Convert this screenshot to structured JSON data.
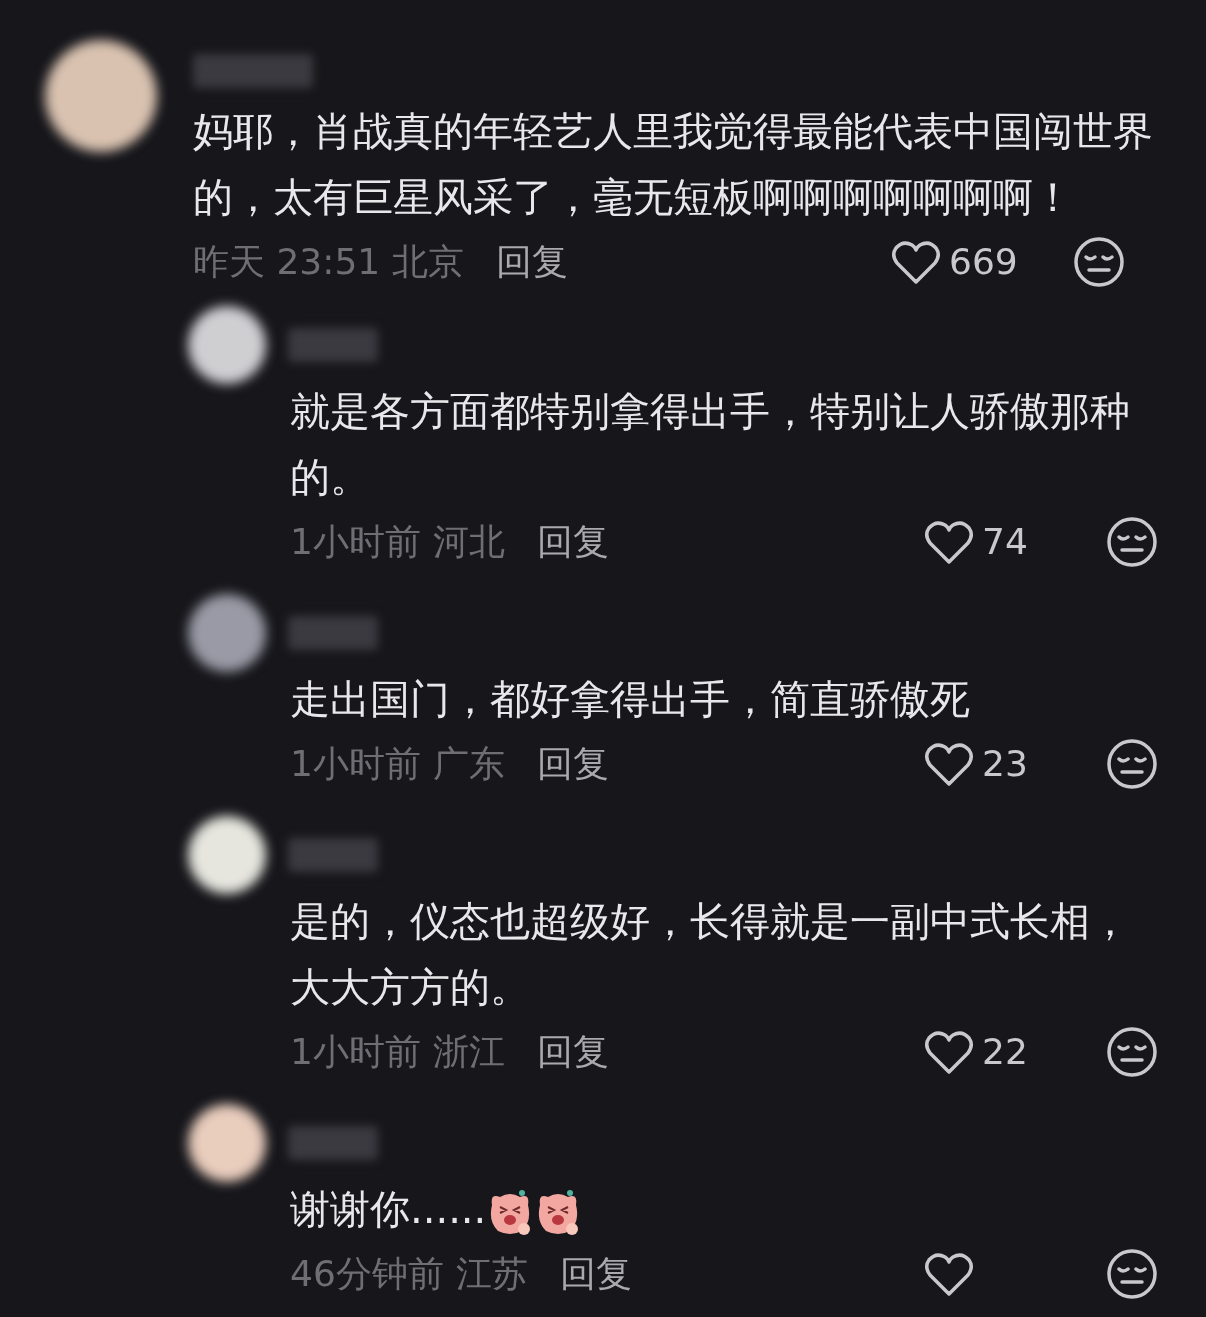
{
  "comment": {
    "text": "妈耶，肖战真的年轻艺人里我觉得最能代表中国闯世界的，太有巨星风采了，毫无短板啊啊啊啊啊啊啊！",
    "time": "昨天 23:51",
    "location": "北京",
    "reply_label": "回复",
    "likes": "669",
    "replies": [
      {
        "text": "就是各方面都特别拿得出手，特别让人骄傲那种的。",
        "time": "1小时前",
        "location": "河北",
        "reply_label": "回复",
        "likes": "74"
      },
      {
        "text": "走出国门，都好拿得出手，简直骄傲死",
        "time": "1小时前",
        "location": "广东",
        "reply_label": "回复",
        "likes": "23"
      },
      {
        "text": "是的，仪态也超级好，长得就是一副中式长相，大大方方的。",
        "time": "1小时前",
        "location": "浙江",
        "reply_label": "回复",
        "likes": "22"
      },
      {
        "text": "谢谢你......",
        "stickers": [
          {
            "kind": "laughing"
          },
          {
            "kind": "laughing"
          }
        ],
        "time": "46分钟前",
        "location": "江苏",
        "reply_label": "回复"
      }
    ]
  }
}
